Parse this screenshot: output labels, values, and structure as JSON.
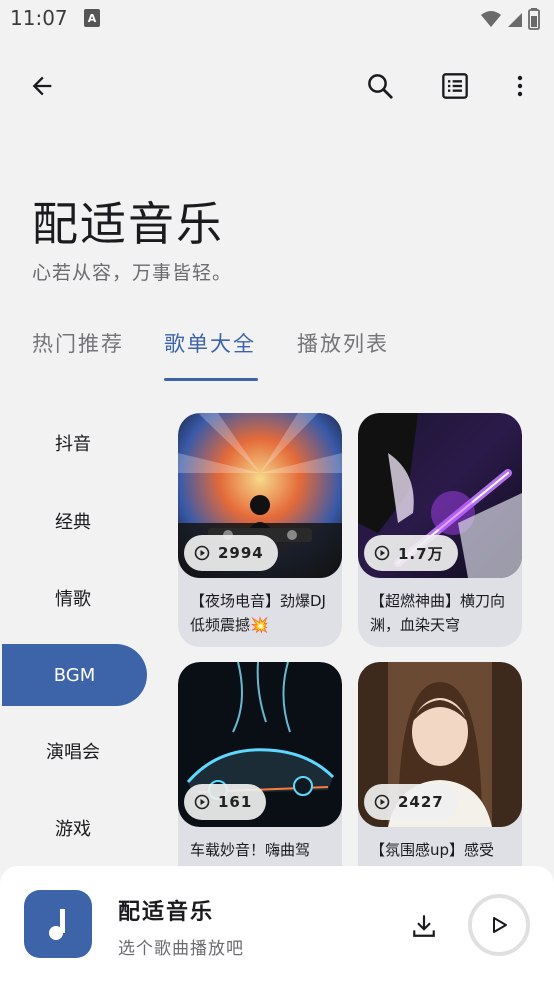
{
  "status_bar": {
    "time": "11:07",
    "notif_icon": "A"
  },
  "app_bar": {
    "back_icon": "arrow-back-icon",
    "search_icon": "search-icon",
    "list_icon": "list-icon",
    "more_icon": "more-vert-icon"
  },
  "header": {
    "title": "配适音乐",
    "subtitle": "心若从容，万事皆轻。"
  },
  "tabs": [
    {
      "label": "热门推荐"
    },
    {
      "label": "歌单大全"
    },
    {
      "label": "播放列表"
    }
  ],
  "categories": [
    {
      "label": "抖音"
    },
    {
      "label": "经典"
    },
    {
      "label": "情歌"
    },
    {
      "label": "BGM"
    },
    {
      "label": "演唱会"
    },
    {
      "label": "游戏"
    }
  ],
  "active_category": "BGM",
  "playlists": [
    {
      "plays": "2994",
      "title": "【夜场电音】劲爆DJ低频震撼💥"
    },
    {
      "plays": "1.7万",
      "title": "【超燃神曲】横刀向渊，血染天穹"
    },
    {
      "plays": "161",
      "title": "车载妙音！嗨曲驾"
    },
    {
      "plays": "2427",
      "title": "【氛围感up】感受"
    }
  ],
  "player": {
    "title": "配适音乐",
    "subtitle": "选个歌曲播放吧",
    "accent": "#3d64a8"
  },
  "colors": {
    "accent": "#3d64a8",
    "background": "#f2f2f2"
  }
}
